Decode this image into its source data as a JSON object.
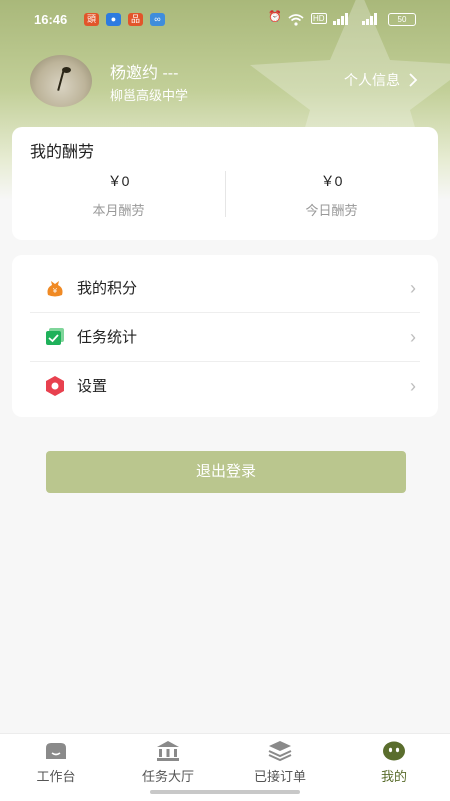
{
  "status_bar": {
    "time": "16:46",
    "battery": "50",
    "hd": "HD"
  },
  "profile": {
    "name": "杨邀约 ---",
    "school": "柳邕高级中学",
    "info_link": "个人信息"
  },
  "earnings": {
    "title": "我的酬劳",
    "month": {
      "amount": "￥0",
      "label": "本月酬劳"
    },
    "today": {
      "amount": "￥0",
      "label": "今日酬劳"
    }
  },
  "menu": {
    "items": [
      {
        "label": "我的积分",
        "icon": "points-bag-icon"
      },
      {
        "label": "任务统计",
        "icon": "task-stats-icon"
      },
      {
        "label": "设置",
        "icon": "settings-icon"
      }
    ]
  },
  "logout_label": "退出登录",
  "tabs": [
    {
      "label": "工作台",
      "icon": "workbench-icon",
      "active": false
    },
    {
      "label": "任务大厅",
      "icon": "task-hall-icon",
      "active": false
    },
    {
      "label": "已接订单",
      "icon": "orders-icon",
      "active": false
    },
    {
      "label": "我的",
      "icon": "profile-icon",
      "active": true
    }
  ],
  "colors": {
    "accent": "#bac68e",
    "header": "#a9b87a",
    "active_tab": "#5a6d2d"
  }
}
